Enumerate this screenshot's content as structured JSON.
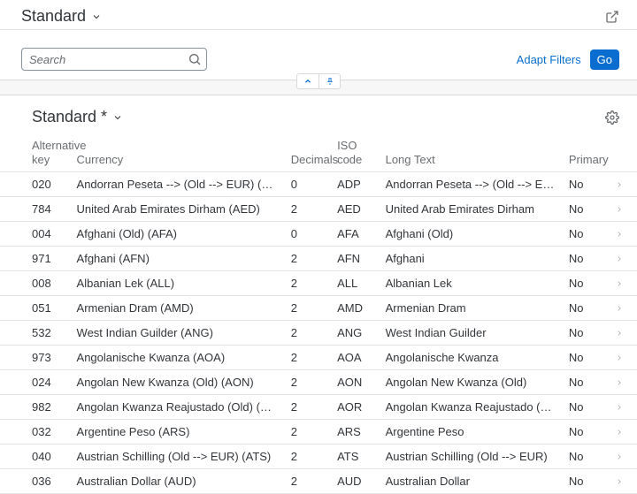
{
  "header": {
    "variant": "Standard"
  },
  "filterBar": {
    "searchPlaceholder": "Search",
    "adaptFilters": "Adapt Filters",
    "go": "Go"
  },
  "tableHeader": {
    "variant": "Standard *"
  },
  "columns": {
    "altKey": "Alternative key",
    "currency": "Currency",
    "decimals": "Decimals",
    "isoCode": "ISO code",
    "longText": "Long Text",
    "primary": "Primary"
  },
  "rows": [
    {
      "alt": "020",
      "currency": "Andorran Peseta --> (Old --> EUR) (ADP)",
      "dec": "0",
      "iso": "ADP",
      "long": "Andorran Peseta --> (Old --> EUR)",
      "prim": "No"
    },
    {
      "alt": "784",
      "currency": "United Arab Emirates Dirham (AED)",
      "dec": "2",
      "iso": "AED",
      "long": "United Arab Emirates Dirham",
      "prim": "No"
    },
    {
      "alt": "004",
      "currency": "Afghani (Old) (AFA)",
      "dec": "0",
      "iso": "AFA",
      "long": "Afghani (Old)",
      "prim": "No"
    },
    {
      "alt": "971",
      "currency": "Afghani (AFN)",
      "dec": "2",
      "iso": "AFN",
      "long": "Afghani",
      "prim": "No"
    },
    {
      "alt": "008",
      "currency": "Albanian Lek (ALL)",
      "dec": "2",
      "iso": "ALL",
      "long": "Albanian Lek",
      "prim": "No"
    },
    {
      "alt": "051",
      "currency": "Armenian Dram (AMD)",
      "dec": "2",
      "iso": "AMD",
      "long": "Armenian Dram",
      "prim": "No"
    },
    {
      "alt": "532",
      "currency": "West Indian Guilder (ANG)",
      "dec": "2",
      "iso": "ANG",
      "long": "West Indian Guilder",
      "prim": "No"
    },
    {
      "alt": "973",
      "currency": "Angolanische Kwanza (AOA)",
      "dec": "2",
      "iso": "AOA",
      "long": "Angolanische Kwanza",
      "prim": "No"
    },
    {
      "alt": "024",
      "currency": "Angolan New Kwanza (Old) (AON)",
      "dec": "2",
      "iso": "AON",
      "long": "Angolan New Kwanza (Old)",
      "prim": "No"
    },
    {
      "alt": "982",
      "currency": "Angolan Kwanza Reajustado (Old) (AOR)",
      "dec": "2",
      "iso": "AOR",
      "long": "Angolan Kwanza Reajustado (Old)",
      "prim": "No"
    },
    {
      "alt": "032",
      "currency": "Argentine Peso (ARS)",
      "dec": "2",
      "iso": "ARS",
      "long": "Argentine Peso",
      "prim": "No"
    },
    {
      "alt": "040",
      "currency": "Austrian Schilling (Old --> EUR) (ATS)",
      "dec": "2",
      "iso": "ATS",
      "long": "Austrian Schilling (Old --> EUR)",
      "prim": "No"
    },
    {
      "alt": "036",
      "currency": "Australian Dollar (AUD)",
      "dec": "2",
      "iso": "AUD",
      "long": "Australian Dollar",
      "prim": "No"
    }
  ]
}
